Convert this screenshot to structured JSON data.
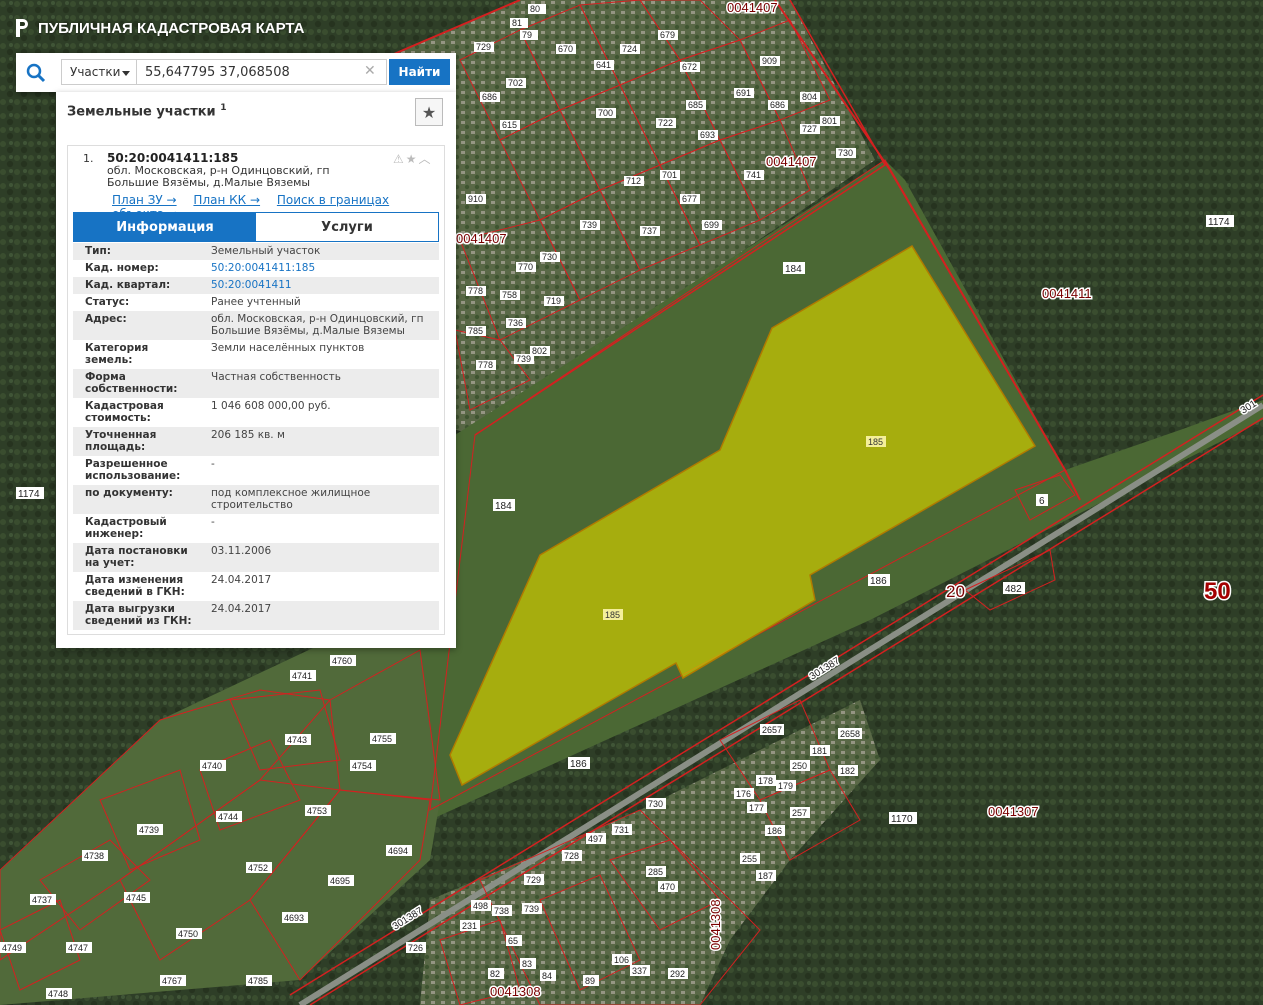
{
  "app": {
    "title": "ПУБЛИЧНАЯ КАДАСТРОВАЯ КАРТА"
  },
  "search": {
    "type_label": "Участки",
    "query": "55,647795 37,068508",
    "clear_glyph": "✕",
    "button_label": "Найти"
  },
  "panel": {
    "title": "Земельные участки",
    "count_sup": "1",
    "item": {
      "index": "1.",
      "cad_number": "50:20:0041411:185",
      "address": "обл. Московская, р-н Одинцовский, гп Большие Вязёмы, д.Малые Вяземы",
      "links": [
        "План ЗУ →",
        "План КК →",
        "Поиск в границах объекта →"
      ],
      "tabs": [
        "Информация",
        "Услуги"
      ],
      "rows": [
        {
          "k": "Тип:",
          "v": "Земельный участок"
        },
        {
          "k": "Кад. номер:",
          "v": "50:20:0041411:185"
        },
        {
          "k": "Кад. квартал:",
          "v": "50:20:0041411"
        },
        {
          "k": "Статус:",
          "v": "Ранее учтенный"
        },
        {
          "k": "Адрес:",
          "v": "обл. Московская, р-н Одинцовский, гп Большие Вязёмы, д.Малые Вяземы"
        },
        {
          "k": "Категория земель:",
          "v": "Земли населённых пунктов"
        },
        {
          "k": "Форма собственности:",
          "v": "Частная собственность"
        },
        {
          "k": "Кадастровая стоимость:",
          "v": "1 046 608 000,00 руб."
        },
        {
          "k": "Уточненная площадь:",
          "v": "206 185 кв. м"
        },
        {
          "k": "Разрешенное использование:",
          "v": "-"
        },
        {
          "k": "по документу:",
          "v": "под комплексное жилищное строительство"
        },
        {
          "k": "Кадастровый инженер:",
          "v": "-"
        },
        {
          "k": "Дата постановки на учет:",
          "v": "03.11.2006"
        },
        {
          "k": "Дата изменения сведений в ГКН:",
          "v": "24.04.2017"
        },
        {
          "k": "Дата выгрузки сведений из ГКН:",
          "v": "24.04.2017"
        }
      ]
    }
  },
  "map": {
    "colors": {
      "forest": "#2f3f28",
      "field": "#4e6a36",
      "parcel": "#c9c800",
      "boundary": "#d42020"
    },
    "quarters": [
      "0041407",
      "0041407",
      "0041407",
      "0041411",
      "0041307",
      "0041308",
      "0041308"
    ],
    "region": "50",
    "district": "20",
    "road": "301387",
    "road_e": "301",
    "parcel_labels": [
      "185",
      "185"
    ],
    "field_labels": [
      "184",
      "184",
      "186",
      "186",
      "1174",
      "1174",
      "1170",
      "482",
      "6"
    ],
    "west_labels": [
      "4741",
      "4743",
      "4740",
      "4754",
      "4755",
      "4739",
      "4744",
      "4753",
      "4738",
      "4752",
      "4694",
      "4695",
      "4745",
      "4737",
      "4693",
      "4750",
      "4749",
      "4747",
      "4767",
      "4785",
      "4748",
      "4760"
    ],
    "south_labels": [
      "730",
      "731",
      "728",
      "497",
      "729",
      "470",
      "285",
      "498",
      "738",
      "739",
      "726",
      "231",
      "65",
      "83",
      "82",
      "84",
      "89",
      "106",
      "337",
      "292",
      "176",
      "177",
      "178",
      "179",
      "186",
      "187",
      "255",
      "257",
      "250",
      "181",
      "182",
      "2658",
      "2657"
    ],
    "north_labels": [
      "80",
      "81",
      "79",
      "729",
      "702",
      "670",
      "724",
      "641",
      "679",
      "672",
      "691",
      "685",
      "722",
      "615",
      "686",
      "693",
      "686",
      "700",
      "712",
      "701",
      "677",
      "741",
      "730",
      "699",
      "737",
      "739",
      "910",
      "909",
      "804",
      "801",
      "727",
      "730",
      "770",
      "758",
      "778",
      "736",
      "802",
      "739",
      "719",
      "785",
      "778"
    ]
  }
}
